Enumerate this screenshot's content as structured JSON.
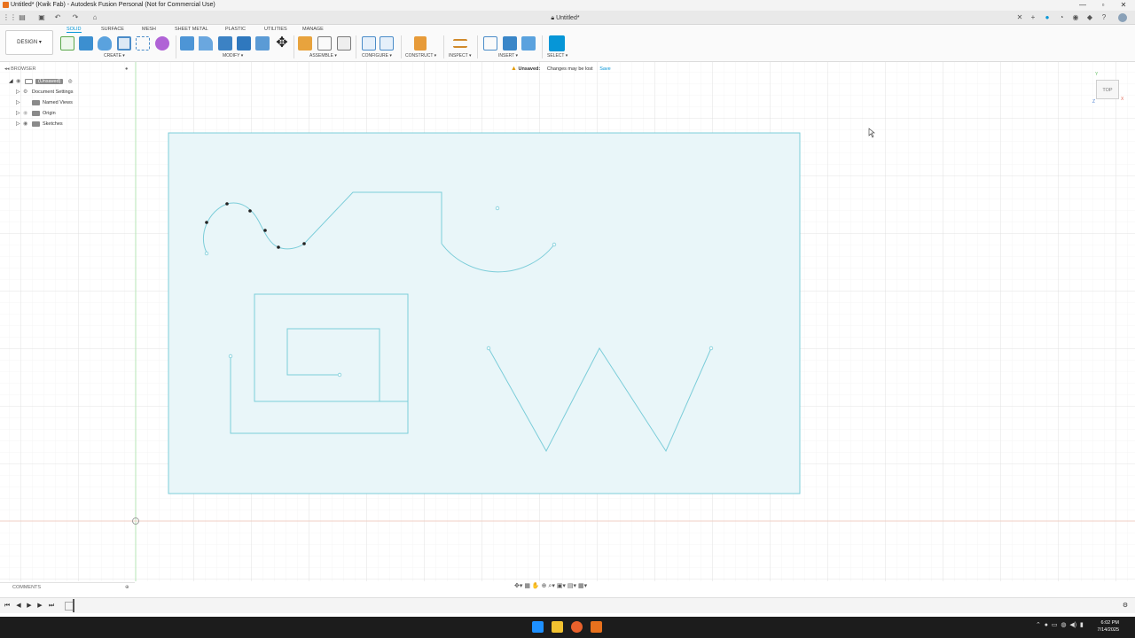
{
  "window": {
    "title": "Untitled* (Kwik Fab) - Autodesk Fusion Personal (Not for Commercial Use)",
    "controls": [
      "minimize-icon",
      "maximize-icon",
      "close-icon"
    ]
  },
  "document_tab": {
    "label": "Untitled*",
    "lock_icon": "lock-icon"
  },
  "toolbar": {
    "design_label": "DESIGN ▾",
    "tabs": [
      {
        "label": "SOLID",
        "active": true
      },
      {
        "label": "SURFACE"
      },
      {
        "label": "MESH"
      },
      {
        "label": "SHEET METAL"
      },
      {
        "label": "PLASTIC"
      },
      {
        "label": "UTILITIES"
      },
      {
        "label": "MANAGE"
      }
    ],
    "groups": [
      {
        "label": "CREATE ▾"
      },
      {
        "label": "MODIFY ▾"
      },
      {
        "label": "ASSEMBLE ▾"
      },
      {
        "label": "CONFIGURE ▾"
      },
      {
        "label": "CONSTRUCT ▾"
      },
      {
        "label": "INSPECT ▾"
      },
      {
        "label": "INSERT ▾"
      },
      {
        "label": "SELECT ▾"
      }
    ]
  },
  "status": {
    "unsaved_label": "Unsaved:",
    "message": "Changes may be lost",
    "save_label": "Save"
  },
  "browser": {
    "header": "BROWSER",
    "root": "(Unsaved)",
    "items": [
      {
        "label": "Document Settings",
        "icon": "gear-icon"
      },
      {
        "label": "Named Views",
        "icon": "folder-icon"
      },
      {
        "label": "Origin",
        "icon": "folder-icon"
      },
      {
        "label": "Sketches",
        "icon": "folder-icon"
      }
    ]
  },
  "viewcube": {
    "label": "TOP",
    "axis_x": "X",
    "axis_y": "Y",
    "axis_z": "Z"
  },
  "comments": {
    "header": "COMMENTS"
  },
  "taskbar": {
    "time": "6:02 PM",
    "date": "7/14/2025"
  },
  "colors": {
    "accent": "#0696d7",
    "sketch_line": "#7ccdd9",
    "sketch_fill": "#e9f6f9",
    "grid": "#e4e4e4",
    "origin_y": "#b5e6b5",
    "origin_x": "#f1cfc4"
  }
}
